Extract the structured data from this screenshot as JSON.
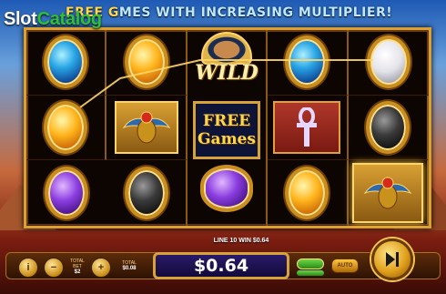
{
  "watermark": {
    "part1": "Slot",
    "part2": "Catalog"
  },
  "banner": {
    "part1": "FREE G",
    "part2": "MES WITH INCREASING MULTIPLIER!"
  },
  "reels": {
    "wild_label": "WILD",
    "free_games_line1": "FREE",
    "free_games_line2": "Games",
    "grid": [
      [
        "blue-gem",
        "yellow-gem",
        "wild",
        "blue-gem",
        "white-gem"
      ],
      [
        "yellow-gem",
        "scarab",
        "free-games",
        "ankh",
        "black-gem"
      ],
      [
        "purple-gem",
        "black-gem",
        "purple-gem",
        "yellow-gem",
        "scarab"
      ]
    ]
  },
  "controls": {
    "line_win": "LINE 10 WIN $0.64",
    "total_bet_label": "TOTAL BET",
    "total_bet_value": "$2",
    "total_label": "TOTAL",
    "total_value": "$0.08",
    "win_amount": "$0.64",
    "auto_label": "AUTO",
    "info_symbol": "i",
    "minus_symbol": "−",
    "plus_symbol": "+"
  },
  "colors": {
    "frame": "#d9a033",
    "win_panel": "#2a1a6a",
    "spin": "#e0a01c"
  }
}
